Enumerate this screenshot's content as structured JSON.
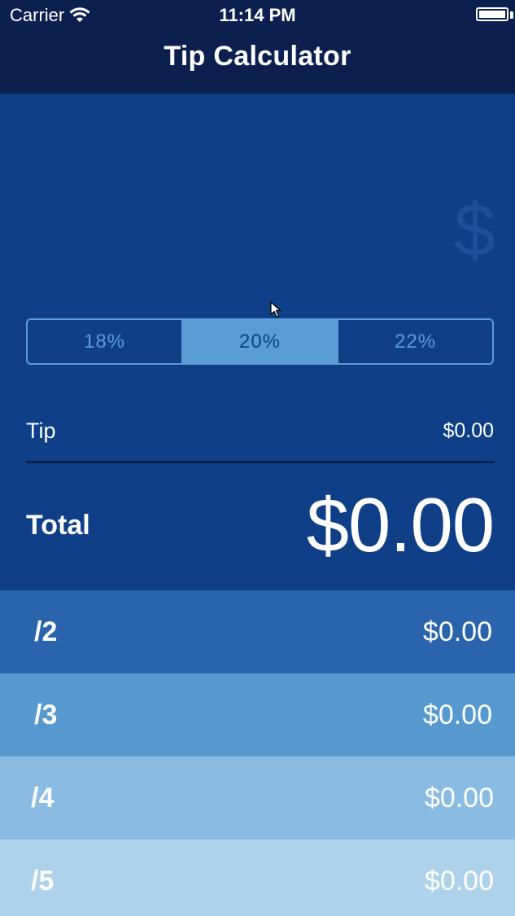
{
  "status_bar": {
    "carrier": "Carrier",
    "time": "11:14 PM"
  },
  "nav": {
    "title": "Tip Calculator"
  },
  "bill": {
    "placeholder": "$",
    "value": ""
  },
  "tip_options": {
    "items": [
      "18%",
      "20%",
      "22%"
    ],
    "selected": "20%"
  },
  "tip": {
    "label": "Tip",
    "value": "$0.00"
  },
  "total": {
    "label": "Total",
    "value": "$0.00"
  },
  "splits": [
    {
      "label": "/2",
      "value": "$0.00",
      "color": "#2a64ac"
    },
    {
      "label": "/3",
      "value": "$0.00",
      "color": "#5699ce"
    },
    {
      "label": "/4",
      "value": "$0.00",
      "color": "#8abce3"
    },
    {
      "label": "/5",
      "value": "$0.00",
      "color": "#aed2ea"
    }
  ],
  "colors": {
    "nav_bar": "#0c2050",
    "main_background": "#0f3f86",
    "accent": "#5b9bd6",
    "divider": "#0a214f"
  }
}
